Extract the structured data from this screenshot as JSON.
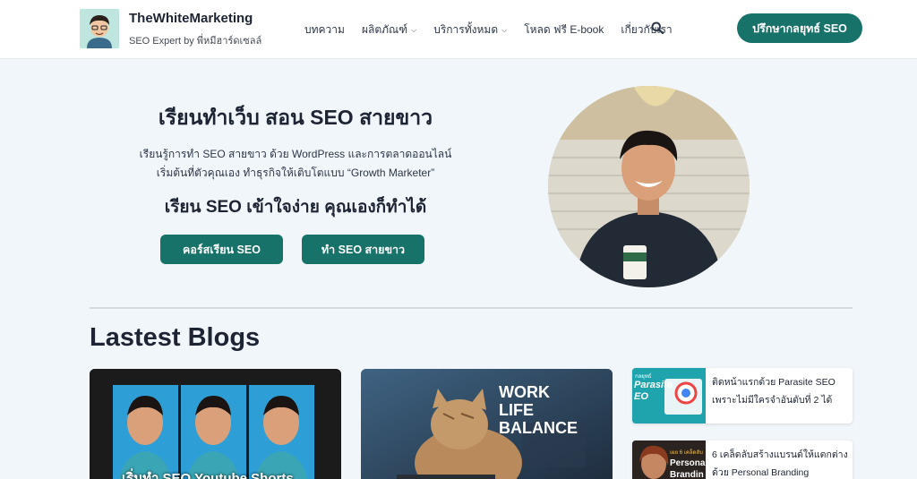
{
  "brand": {
    "name": "TheWhiteMarketing",
    "tagline": "SEO Expert by พี่หมีฮาร์ดเซลล์"
  },
  "nav": [
    {
      "label": "บทความ",
      "dropdown": false
    },
    {
      "label": "ผลิตภัณฑ์",
      "dropdown": true
    },
    {
      "label": "บริการทั้งหมด",
      "dropdown": true
    },
    {
      "label": "โหลด ฟรี E-book",
      "dropdown": false
    },
    {
      "label": "เกี่ยวกับเรา",
      "dropdown": false
    }
  ],
  "header_cta": "ปรึกษากลยุทธ์ SEO",
  "hero": {
    "title": "เรียนทำเว็บ สอน SEO สายขาว",
    "sub_line1": "เรียนรู้การทำ SEO สายขาว ด้วย WordPress และการตลาดออนไลน์",
    "sub_line2": "เริ่มต้นที่ตัวคุณเอง ทำธุรกิจให้เติบโตแบบ “Growth Marketer”",
    "tagline": "เรียน SEO เข้าใจง่าย คุณเองก็ทำได้",
    "btn_course": "คอร์สเรียน SEO",
    "btn_whitehat": "ทำ SEO สายขาว"
  },
  "blogs": {
    "section_title": "Lastest Blogs",
    "card1_caption": "เริ่มทำ SEO Youtube Shorts",
    "card2_caption_l1": "WORK",
    "card2_caption_l2": "LIFE",
    "card2_caption_l3": "BALANCE",
    "side_posts": [
      {
        "title": "ติดหน้าแรกด้วย Parasite SEO เพราะไม่มีใครจำอันดับที่ 2 ได้",
        "thumb_l1": "กลยุทธ์",
        "thumb_l2": "Parasite",
        "thumb_l3": "EO"
      },
      {
        "title": "6 เคล็ดลับสร้างแบรนด์ให้แตกต่างด้วย Personal Branding",
        "thumb_l1": "เผย 6 เคล็ดลับ",
        "thumb_l2": "Persona",
        "thumb_l3": "Brandin"
      }
    ]
  },
  "colors": {
    "accent": "#17726a",
    "page_bg": "#f1f6fa",
    "text": "#1d2433"
  },
  "icons": {
    "search": "search-icon",
    "chevron": "chevron-down-icon"
  }
}
